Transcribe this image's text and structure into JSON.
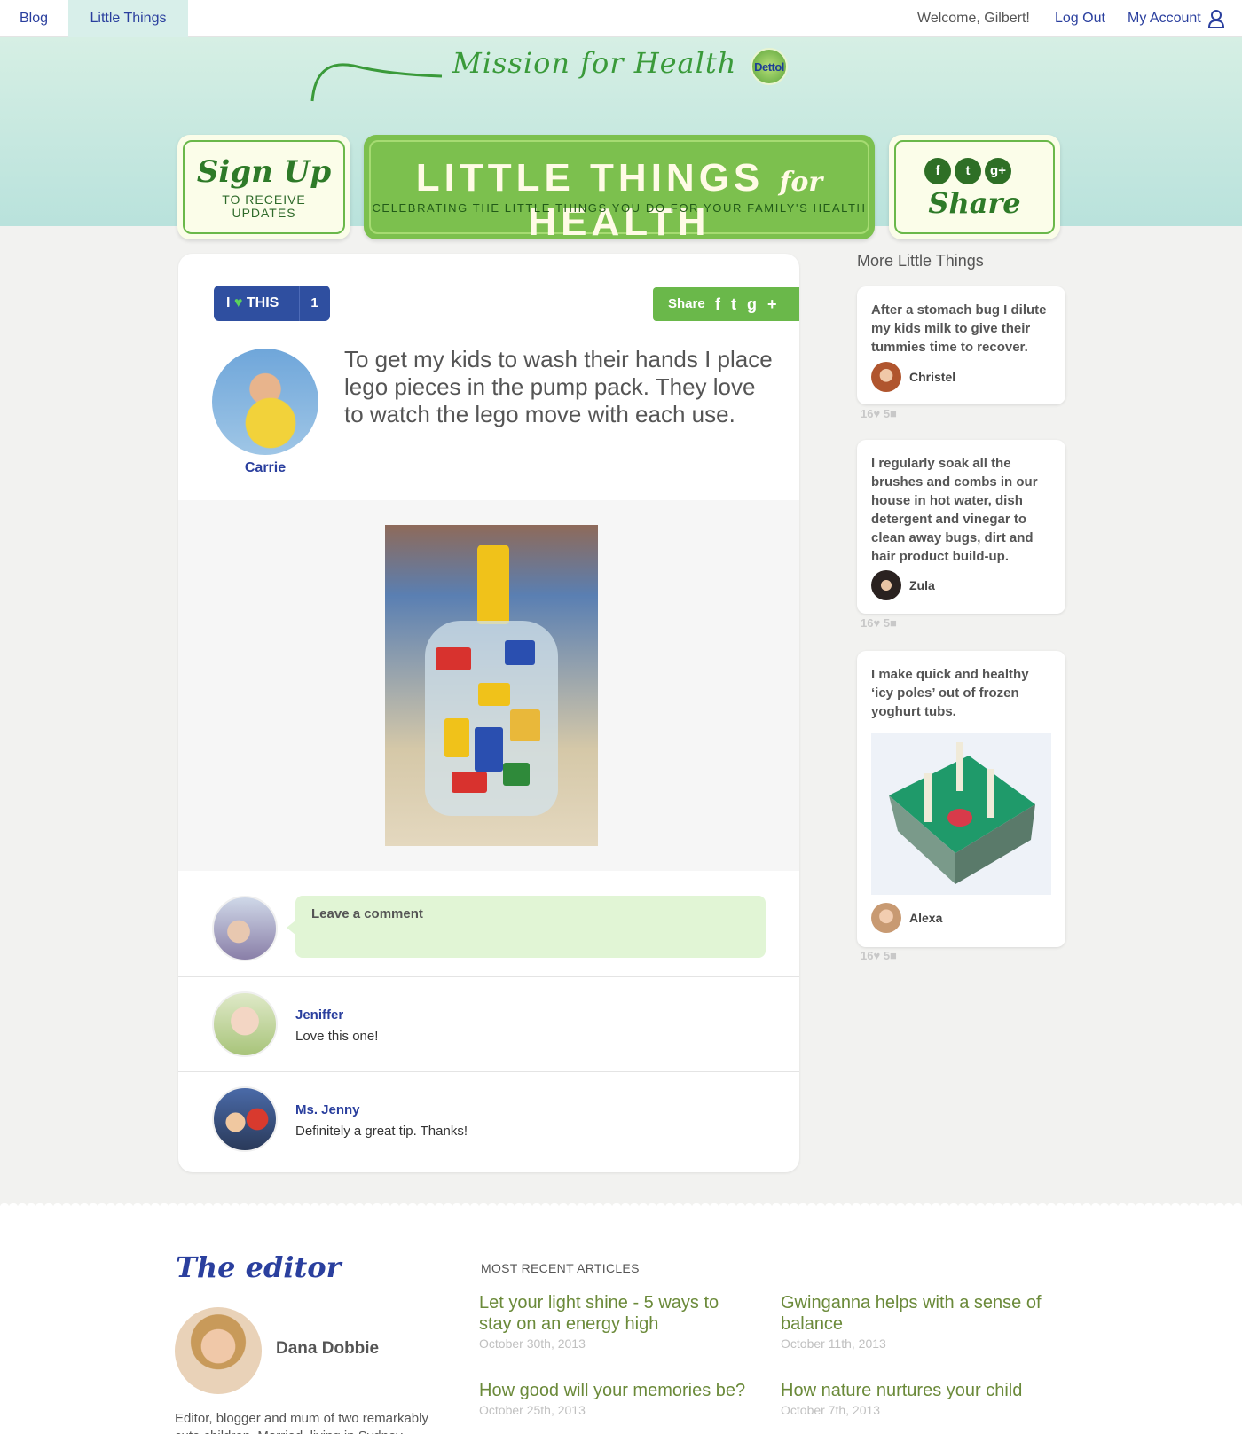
{
  "nav": {
    "blog": "Blog",
    "little_things": "Little Things",
    "welcome": "Welcome, Gilbert!",
    "logout": "Log Out",
    "my_account": "My Account"
  },
  "banner": {
    "mission": "Mission for Health",
    "brand": "Dettol",
    "signup_title": "Sign Up",
    "signup_sub": "TO RECEIVE UPDATES",
    "main_title_a": "LITTLE THINGS",
    "main_title_for": "for",
    "main_title_b": "HEALTH",
    "main_sub": "CELEBRATING THE LITTLE THINGS YOU DO FOR YOUR FAMILY'S HEALTH",
    "share_title": "Share",
    "share_icons": [
      "f",
      "t",
      "g+"
    ]
  },
  "post": {
    "love_i": "I",
    "love_this": "THIS",
    "love_count": "1",
    "share_label": "Share",
    "author": "Carrie",
    "tip": "To get my kids to wash their hands I place lego pieces in the pump pack. They love to watch the lego move with each use.",
    "comment_placeholder": "Leave a comment",
    "comments": [
      {
        "name": "Jeniffer",
        "text": "Love this one!"
      },
      {
        "name": "Ms. Jenny",
        "text": "Definitely a great tip. Thanks!"
      }
    ]
  },
  "sidebar": {
    "title": "More Little Things",
    "items": [
      {
        "text": "After a stomach bug I dilute my kids milk to give their tummies time to recover.",
        "name": "Christel",
        "likes": "16",
        "comments": "5"
      },
      {
        "text": "I regularly soak all the brushes and combs in our house in hot water, dish detergent and vinegar to clean away bugs, dirt and hair product build-up.",
        "name": "Zula",
        "likes": "16",
        "comments": "5"
      },
      {
        "text": "I make quick and healthy ‘icy poles’ out of frozen yoghurt tubs.",
        "name": "Alexa",
        "likes": "16",
        "comments": "5"
      }
    ]
  },
  "footer": {
    "editor_title": "The editor",
    "editor_name": "Dana Dobbie",
    "editor_bio": "Editor, blogger and mum of two remarkably cute children. Married, living in Sydney.",
    "recent_title": "MOST RECENT ARTICLES",
    "articles": [
      {
        "title": "Let your light shine - 5 ways to stay on an energy high",
        "date": "October 30th, 2013"
      },
      {
        "title": "Gwinganna helps with a sense of balance",
        "date": "October 11th, 2013"
      },
      {
        "title": "How good will your memories be?",
        "date": "October 25th, 2013"
      },
      {
        "title": "How nature nurtures your child",
        "date": "October 7th, 2013"
      }
    ]
  }
}
